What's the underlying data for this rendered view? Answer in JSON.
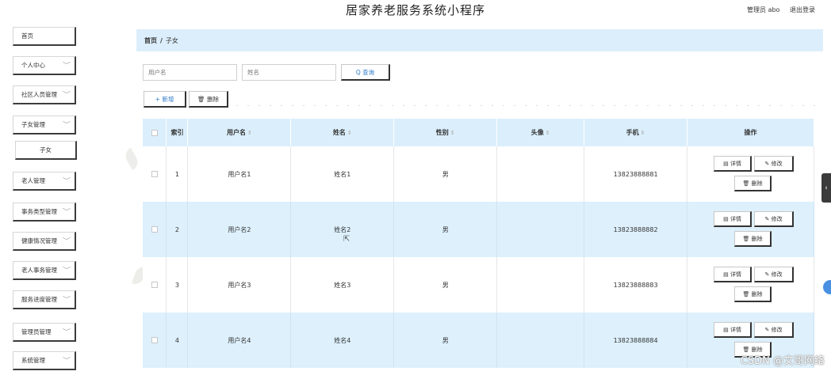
{
  "header": {
    "title": "居家养老服务系统小程序",
    "user_label": "管理员 abo",
    "logout_label": "退出登录"
  },
  "sidebar": {
    "items": [
      {
        "label": "首页",
        "chev": ""
      },
      {
        "label": "个人中心",
        "chev": "﹀"
      },
      {
        "label": "社区人员管理",
        "chev": "﹀"
      },
      {
        "label": "子女管理",
        "chev": "﹀"
      },
      {
        "label": "子女",
        "chev": ""
      },
      {
        "label": "老人管理",
        "chev": "﹀"
      },
      {
        "label": "事务类型管理",
        "chev": "﹀"
      },
      {
        "label": "健康情况管理",
        "chev": "﹀"
      },
      {
        "label": "老人事务管理",
        "chev": "﹀"
      },
      {
        "label": "服务进度管理",
        "chev": "﹀"
      },
      {
        "label": "管理员管理",
        "chev": "﹀"
      },
      {
        "label": "系统管理",
        "chev": "﹀"
      }
    ]
  },
  "breadcrumb": {
    "home": "首页",
    "sep": "/",
    "current": "子女"
  },
  "search": {
    "username_placeholder": "用户名",
    "name_placeholder": "姓名",
    "query_label": "Q 查询"
  },
  "actions": {
    "add_label": "+ 新增",
    "delete_label": "🗑 删除"
  },
  "table": {
    "headers": {
      "index": "索引",
      "username": "用户名",
      "name": "姓名",
      "gender": "性别",
      "avatar": "头像",
      "phone": "手机",
      "ops": "操作"
    },
    "sort_glyph": "⇕",
    "op_labels": {
      "detail": "▤ 详情",
      "edit": "✎ 修改",
      "delete": "🗑 删除"
    },
    "rows": [
      {
        "index": "1",
        "username": "用户名1",
        "name": "姓名1",
        "gender": "男",
        "avatar": "",
        "phone": "13823888881"
      },
      {
        "index": "2",
        "username": "用户名2",
        "name": "姓名2",
        "gender": "男",
        "avatar": "",
        "phone": "13823888882"
      },
      {
        "index": "3",
        "username": "用户名3",
        "name": "姓名3",
        "gender": "男",
        "avatar": "",
        "phone": "13823888883"
      },
      {
        "index": "4",
        "username": "用户名4",
        "name": "姓名4",
        "gender": "男",
        "avatar": "",
        "phone": "13823888884"
      }
    ]
  },
  "side_handle_glyph": "‹",
  "watermark": "CSDN @文哥网络"
}
